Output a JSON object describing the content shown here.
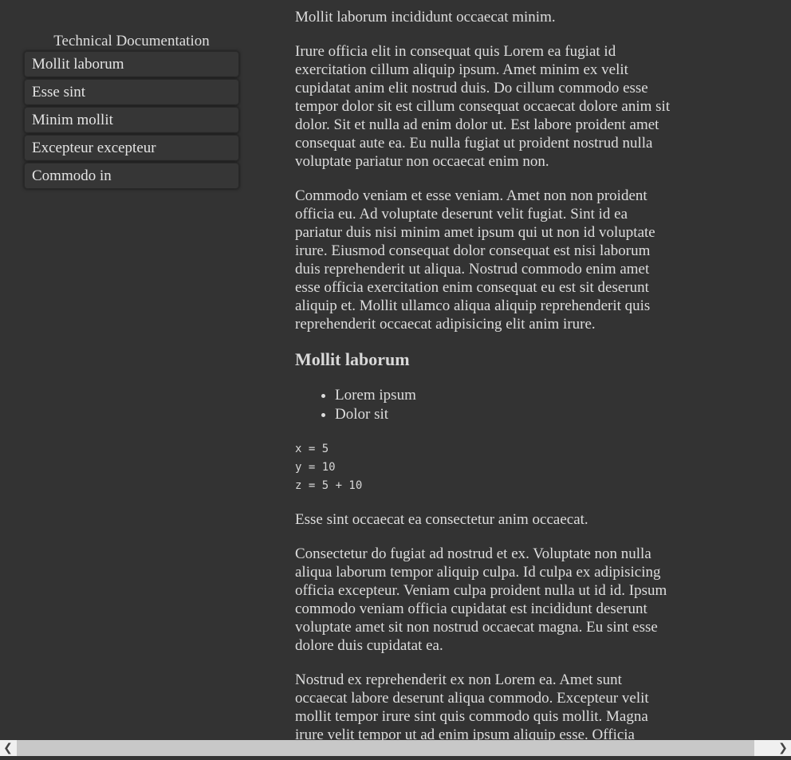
{
  "sidebar": {
    "title": "Technical Documentation",
    "items": [
      {
        "label": "Mollit laborum"
      },
      {
        "label": "Esse sint"
      },
      {
        "label": "Minim mollit"
      },
      {
        "label": "Excepteur excepteur"
      },
      {
        "label": "Commodo in"
      }
    ]
  },
  "main": {
    "intro": "Mollit laborum incididunt occaecat minim.",
    "para1": "Irure officia elit in consequat quis Lorem ea fugiat id exercitation cillum aliquip ipsum. Amet minim ex velit cupidatat anim elit nostrud duis. Do cillum commodo esse tempor dolor sit est cillum consequat occaecat dolore anim sit dolor. Sit et nulla ad enim dolor ut. Est labore proident amet consequat aute ea. Eu nulla fugiat ut proident nostrud nulla voluptate pariatur non occaecat enim non.",
    "para2": "Commodo veniam et esse veniam. Amet non non proident officia eu. Ad voluptate deserunt velit fugiat. Sint id ea pariatur duis nisi minim amet ipsum qui ut non id voluptate irure. Eiusmod consequat dolor consequat est nisi laborum duis reprehenderit ut aliqua. Nostrud commodo enim amet esse officia exercitation enim consequat eu est sit deserunt aliquip et. Mollit ullamco aliqua aliquip reprehenderit quis reprehenderit occaecat adipisicing elit anim irure.",
    "heading": "Mollit laborum",
    "list": [
      "Lorem ipsum",
      "Dolor sit"
    ],
    "code": [
      "x = 5",
      "y = 10",
      "z = 5 + 10"
    ],
    "para3": "Esse sint occaecat ea consectetur anim occaecat.",
    "para4": "Consectetur do fugiat ad nostrud et ex. Voluptate non nulla aliqua laborum tempor aliquip culpa. Id culpa ex adipisicing officia excepteur. Veniam culpa proident nulla ut id id. Ipsum commodo veniam officia cupidatat est incididunt deserunt voluptate amet sit non nostrud occaecat magna. Eu sint esse dolore duis cupidatat ea.",
    "para5": "Nostrud ex reprehenderit ex non Lorem ea. Amet sunt occaecat labore deserunt aliqua commodo. Excepteur velit mollit tempor irure sint quis commodo quis mollit. Magna irure velit tempor ut ad enim ipsum aliquip esse. Officia"
  },
  "scrollbar": {
    "left_icon": "chevron-left-icon",
    "right_icon": "chevron-right-icon"
  }
}
